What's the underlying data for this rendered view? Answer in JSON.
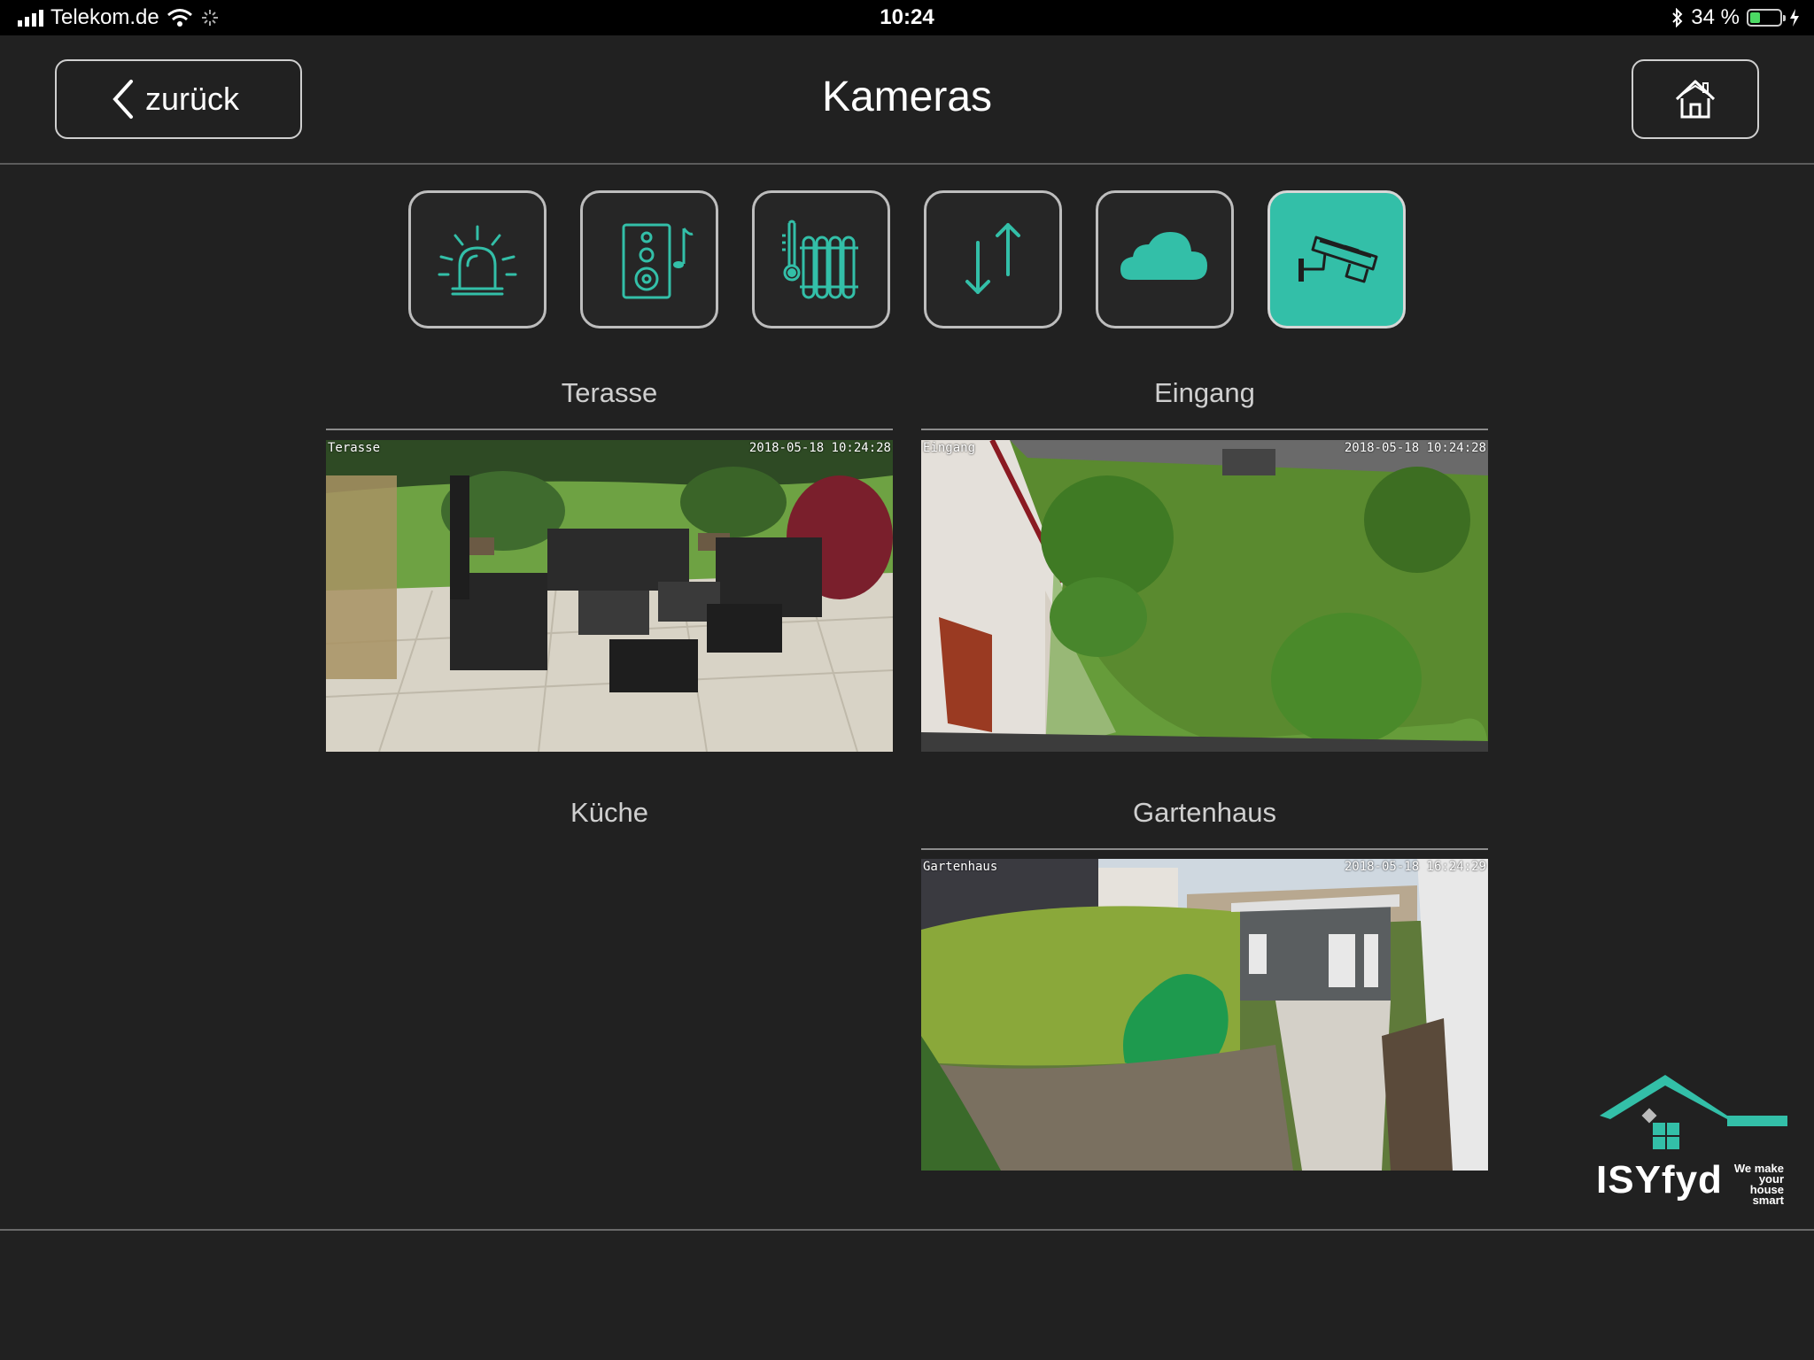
{
  "status_bar": {
    "carrier": "Telekom.de",
    "time": "10:24",
    "battery": "34 %",
    "battery_level": 0.34,
    "icons": [
      "signal-icon",
      "wifi-icon",
      "activity-spinner-icon",
      "bluetooth-icon",
      "battery-icon",
      "charging-icon"
    ]
  },
  "header": {
    "back_label": "zurück",
    "title": "Kameras",
    "home_icon": "home-icon"
  },
  "categories": [
    {
      "name": "alarm",
      "icon": "siren-icon",
      "active": false
    },
    {
      "name": "audio",
      "icon": "speaker-music-icon",
      "active": false
    },
    {
      "name": "heating",
      "icon": "radiator-thermometer-icon",
      "active": false
    },
    {
      "name": "shutters",
      "icon": "up-down-arrows-icon",
      "active": false
    },
    {
      "name": "weather",
      "icon": "cloud-icon",
      "active": false
    },
    {
      "name": "cameras",
      "icon": "security-camera-icon",
      "active": true
    }
  ],
  "cameras": [
    {
      "title": "Terasse",
      "osd_name": "Terasse",
      "osd_time": "2018-05-18 10:24:28",
      "has_feed": true
    },
    {
      "title": "Eingang",
      "osd_name": "Eingang",
      "osd_time": "2018-05-18 10:24:28",
      "has_feed": true
    },
    {
      "title": "Küche",
      "osd_name": "",
      "osd_time": "",
      "has_feed": false
    },
    {
      "title": "Gartenhaus",
      "osd_name": "Gartenhaus",
      "osd_time": "2018-05-18 16:24:29",
      "has_feed": true
    }
  ],
  "logo": {
    "name": "ISYfyd",
    "tagline_1": "We make",
    "tagline_2": "your house",
    "tagline_3": "smart"
  },
  "colors": {
    "accent": "#33bfa8",
    "background": "#212121"
  }
}
